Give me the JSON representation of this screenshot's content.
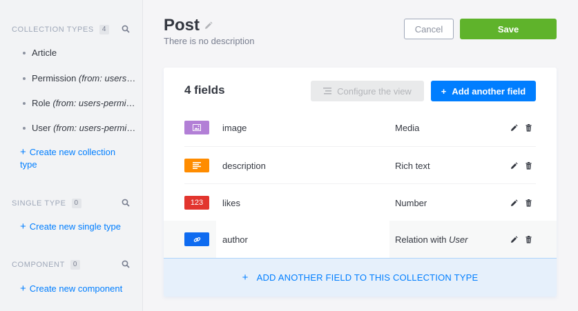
{
  "sidebar": {
    "collection_types": {
      "heading": "Collection Types",
      "count": "4",
      "items": [
        {
          "main": "Article",
          "sub": ""
        },
        {
          "main": "Permission ",
          "sub": "(from: users-permissions)"
        },
        {
          "main": "Role ",
          "sub": "(from: users-permissions)"
        },
        {
          "main": "User ",
          "sub": "(from: users-permissions)"
        }
      ],
      "create_label": "Create new collection type"
    },
    "single_type": {
      "heading": "Single Type",
      "count": "0",
      "create_label": "Create new single type"
    },
    "component": {
      "heading": "Component",
      "count": "0",
      "create_label": "Create new component"
    }
  },
  "header": {
    "title": "Post",
    "subtitle": "There is no description",
    "cancel_label": "Cancel",
    "save_label": "Save"
  },
  "card": {
    "fields_count": "4 fields",
    "configure_label": "Configure the view",
    "add_label": "Add another field",
    "fields": [
      {
        "icon_text": "",
        "icon": "image-icon",
        "color": "#b27fd6",
        "name": "image",
        "type": "Media",
        "type_italic": ""
      },
      {
        "icon_text": "",
        "icon": "text-lines-icon",
        "color": "#ff8c00",
        "name": "description",
        "type": "Rich text",
        "type_italic": ""
      },
      {
        "icon_text": "123",
        "icon": "number-icon",
        "color": "#e2352e",
        "name": "likes",
        "type": "Number",
        "type_italic": ""
      },
      {
        "icon_text": "",
        "icon": "link-icon",
        "color": "#0e6bf0",
        "name": "author",
        "type": "Relation with ",
        "type_italic": "User"
      }
    ],
    "add_bar_label": "ADD ANOTHER FIELD TO THIS COLLECTION TYPE"
  },
  "colors": {
    "primary": "#007eff",
    "save": "#5fb32b"
  }
}
